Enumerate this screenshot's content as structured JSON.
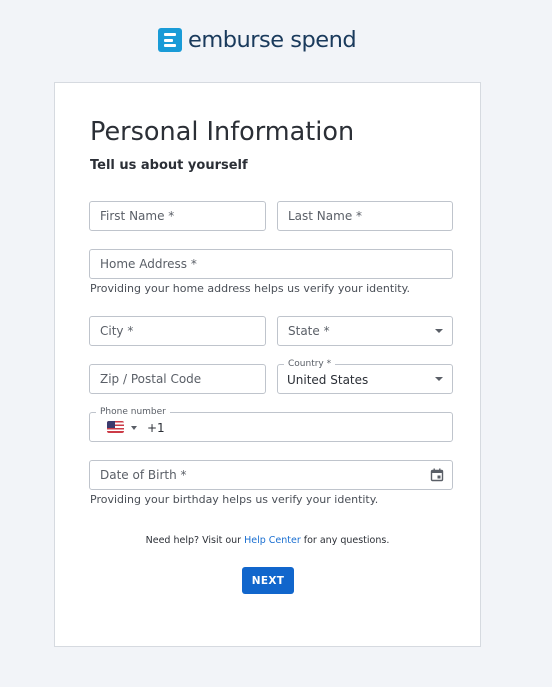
{
  "brand": {
    "name": "emburse spend",
    "accent": "#1a9bd7",
    "text_color": "#1a3a5c"
  },
  "form": {
    "title": "Personal Information",
    "subtitle": "Tell us about yourself",
    "first_name": {
      "placeholder": "First Name *"
    },
    "last_name": {
      "placeholder": "Last Name *"
    },
    "home_address": {
      "placeholder": "Home Address *",
      "helper": "Providing your home address helps us verify your identity."
    },
    "city": {
      "placeholder": "City *"
    },
    "state": {
      "placeholder": "State *"
    },
    "zip": {
      "placeholder": "Zip / Postal Code"
    },
    "country": {
      "label": "Country *",
      "value": "United States"
    },
    "phone": {
      "label": "Phone number",
      "flag": "us-flag-icon",
      "dial_code": "+1"
    },
    "dob": {
      "placeholder": "Date of Birth *",
      "helper": "Providing your birthday helps us verify your identity."
    },
    "help": {
      "prefix": "Need help? Visit our ",
      "link": "Help Center",
      "suffix": " for any questions."
    },
    "next_label": "NEXT",
    "button_color": "#1166cc"
  }
}
